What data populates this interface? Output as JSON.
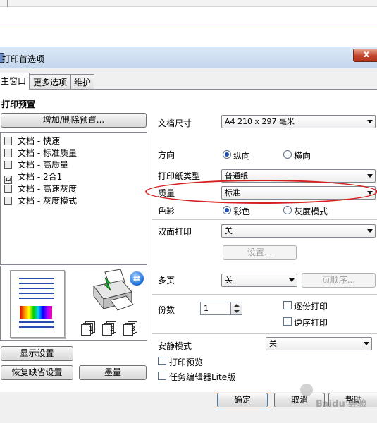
{
  "dialog": {
    "title": "打印首选项",
    "close_label": "x"
  },
  "tabs": [
    {
      "label": "主窗口"
    },
    {
      "label": "更多选项"
    },
    {
      "label": "维护"
    }
  ],
  "left": {
    "section_title": "打印预置",
    "add_remove_label": "增加/删除预置...",
    "presets": [
      {
        "label": "文档 - 快速"
      },
      {
        "label": "文档 - 标准质量"
      },
      {
        "label": "文档 - 高质量"
      },
      {
        "label": "文档 - 2合1",
        "icon_text": "12"
      },
      {
        "label": "文档 - 高速灰度"
      },
      {
        "label": "文档 - 灰度模式"
      }
    ],
    "stack_numbers": [
      "1",
      "2",
      "3"
    ],
    "display_settings_label": "显示设置",
    "restore_defaults_label": "恢复缺省设置",
    "ink_label": "墨量"
  },
  "right": {
    "paper_size": {
      "label": "文档尺寸",
      "value": "A4 210 x 297 毫米"
    },
    "orientation": {
      "label": "方向",
      "options": [
        "纵向",
        "横向"
      ],
      "selected": "纵向"
    },
    "paper_type": {
      "label": "打印纸类型",
      "value": "普通纸"
    },
    "quality": {
      "label": "质量",
      "value": "标准"
    },
    "color": {
      "label": "色彩",
      "options": [
        "彩色",
        "灰度模式"
      ],
      "selected": "彩色"
    },
    "duplex": {
      "label": "双面打印",
      "value": "关",
      "settings_label": "设置..."
    },
    "multipage": {
      "label": "多页",
      "value": "关",
      "order_label": "页顺序..."
    },
    "copies": {
      "label": "份数",
      "value": "1",
      "collate_label": "逐份打印",
      "reverse_label": "逆序打印"
    },
    "quiet_mode": {
      "label": "安静模式",
      "value": "关"
    },
    "print_preview_label": "打印预览",
    "job_arranger_label": "任务编辑器Lite版"
  },
  "footer": {
    "ok_label": "确定",
    "cancel_label": "取消",
    "help_label": "帮助"
  },
  "watermark": {
    "text": "Baidu 经验"
  },
  "colors": {
    "highlight": "#d62020",
    "close_button": "#c0442c",
    "title_bar": "#c4d6ec"
  }
}
